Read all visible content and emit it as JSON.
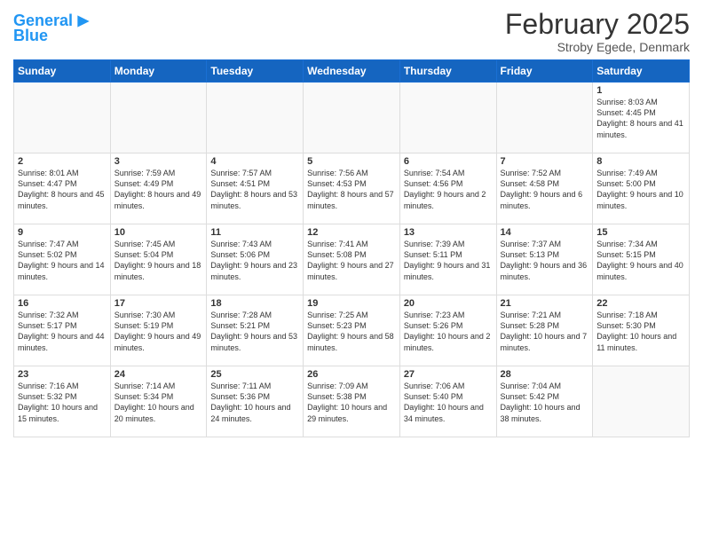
{
  "header": {
    "logo_line1": "General",
    "logo_line2": "Blue",
    "month_title": "February 2025",
    "location": "Stroby Egede, Denmark"
  },
  "days_of_week": [
    "Sunday",
    "Monday",
    "Tuesday",
    "Wednesday",
    "Thursday",
    "Friday",
    "Saturday"
  ],
  "weeks": [
    [
      {
        "day": "",
        "detail": ""
      },
      {
        "day": "",
        "detail": ""
      },
      {
        "day": "",
        "detail": ""
      },
      {
        "day": "",
        "detail": ""
      },
      {
        "day": "",
        "detail": ""
      },
      {
        "day": "",
        "detail": ""
      },
      {
        "day": "1",
        "detail": "Sunrise: 8:03 AM\nSunset: 4:45 PM\nDaylight: 8 hours and 41 minutes."
      }
    ],
    [
      {
        "day": "2",
        "detail": "Sunrise: 8:01 AM\nSunset: 4:47 PM\nDaylight: 8 hours and 45 minutes."
      },
      {
        "day": "3",
        "detail": "Sunrise: 7:59 AM\nSunset: 4:49 PM\nDaylight: 8 hours and 49 minutes."
      },
      {
        "day": "4",
        "detail": "Sunrise: 7:57 AM\nSunset: 4:51 PM\nDaylight: 8 hours and 53 minutes."
      },
      {
        "day": "5",
        "detail": "Sunrise: 7:56 AM\nSunset: 4:53 PM\nDaylight: 8 hours and 57 minutes."
      },
      {
        "day": "6",
        "detail": "Sunrise: 7:54 AM\nSunset: 4:56 PM\nDaylight: 9 hours and 2 minutes."
      },
      {
        "day": "7",
        "detail": "Sunrise: 7:52 AM\nSunset: 4:58 PM\nDaylight: 9 hours and 6 minutes."
      },
      {
        "day": "8",
        "detail": "Sunrise: 7:49 AM\nSunset: 5:00 PM\nDaylight: 9 hours and 10 minutes."
      }
    ],
    [
      {
        "day": "9",
        "detail": "Sunrise: 7:47 AM\nSunset: 5:02 PM\nDaylight: 9 hours and 14 minutes."
      },
      {
        "day": "10",
        "detail": "Sunrise: 7:45 AM\nSunset: 5:04 PM\nDaylight: 9 hours and 18 minutes."
      },
      {
        "day": "11",
        "detail": "Sunrise: 7:43 AM\nSunset: 5:06 PM\nDaylight: 9 hours and 23 minutes."
      },
      {
        "day": "12",
        "detail": "Sunrise: 7:41 AM\nSunset: 5:08 PM\nDaylight: 9 hours and 27 minutes."
      },
      {
        "day": "13",
        "detail": "Sunrise: 7:39 AM\nSunset: 5:11 PM\nDaylight: 9 hours and 31 minutes."
      },
      {
        "day": "14",
        "detail": "Sunrise: 7:37 AM\nSunset: 5:13 PM\nDaylight: 9 hours and 36 minutes."
      },
      {
        "day": "15",
        "detail": "Sunrise: 7:34 AM\nSunset: 5:15 PM\nDaylight: 9 hours and 40 minutes."
      }
    ],
    [
      {
        "day": "16",
        "detail": "Sunrise: 7:32 AM\nSunset: 5:17 PM\nDaylight: 9 hours and 44 minutes."
      },
      {
        "day": "17",
        "detail": "Sunrise: 7:30 AM\nSunset: 5:19 PM\nDaylight: 9 hours and 49 minutes."
      },
      {
        "day": "18",
        "detail": "Sunrise: 7:28 AM\nSunset: 5:21 PM\nDaylight: 9 hours and 53 minutes."
      },
      {
        "day": "19",
        "detail": "Sunrise: 7:25 AM\nSunset: 5:23 PM\nDaylight: 9 hours and 58 minutes."
      },
      {
        "day": "20",
        "detail": "Sunrise: 7:23 AM\nSunset: 5:26 PM\nDaylight: 10 hours and 2 minutes."
      },
      {
        "day": "21",
        "detail": "Sunrise: 7:21 AM\nSunset: 5:28 PM\nDaylight: 10 hours and 7 minutes."
      },
      {
        "day": "22",
        "detail": "Sunrise: 7:18 AM\nSunset: 5:30 PM\nDaylight: 10 hours and 11 minutes."
      }
    ],
    [
      {
        "day": "23",
        "detail": "Sunrise: 7:16 AM\nSunset: 5:32 PM\nDaylight: 10 hours and 15 minutes."
      },
      {
        "day": "24",
        "detail": "Sunrise: 7:14 AM\nSunset: 5:34 PM\nDaylight: 10 hours and 20 minutes."
      },
      {
        "day": "25",
        "detail": "Sunrise: 7:11 AM\nSunset: 5:36 PM\nDaylight: 10 hours and 24 minutes."
      },
      {
        "day": "26",
        "detail": "Sunrise: 7:09 AM\nSunset: 5:38 PM\nDaylight: 10 hours and 29 minutes."
      },
      {
        "day": "27",
        "detail": "Sunrise: 7:06 AM\nSunset: 5:40 PM\nDaylight: 10 hours and 34 minutes."
      },
      {
        "day": "28",
        "detail": "Sunrise: 7:04 AM\nSunset: 5:42 PM\nDaylight: 10 hours and 38 minutes."
      },
      {
        "day": "",
        "detail": ""
      }
    ]
  ]
}
